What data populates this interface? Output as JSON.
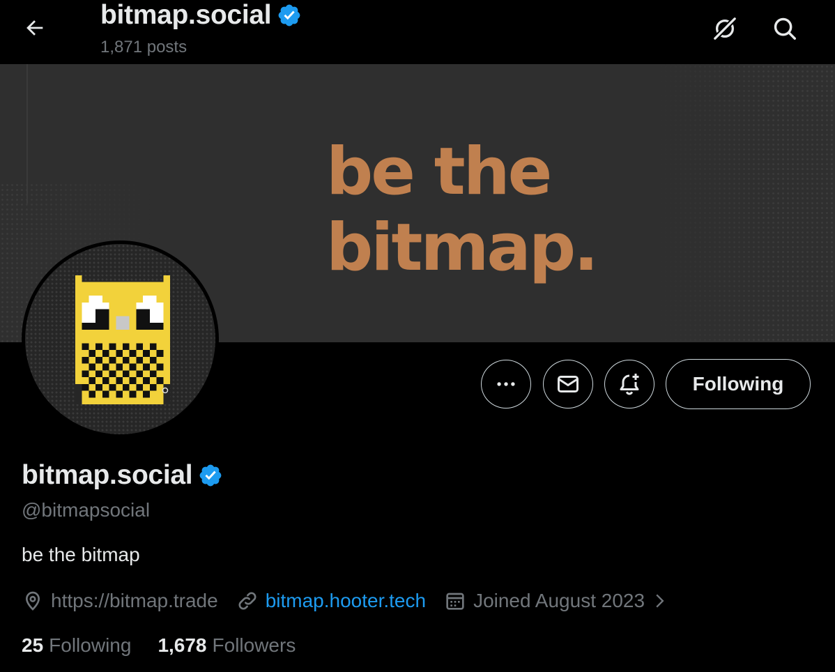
{
  "header": {
    "title": "bitmap.social",
    "posts_count": "1,871 posts"
  },
  "banner": {
    "tagline": "be the bitmap."
  },
  "actions": {
    "following_label": "Following"
  },
  "profile": {
    "display_name": "bitmap.social",
    "handle": "@bitmapsocial",
    "bio": "be the bitmap",
    "location": "https://bitmap.trade",
    "website": "bitmap.hooter.tech",
    "joined": "Joined August 2023",
    "following_count": "25",
    "following_label": "Following",
    "followers_count": "1,678",
    "followers_label": "Followers"
  },
  "colors": {
    "background": "#000000",
    "accent_blue": "#1d9bf0",
    "banner_bg": "#2f2f2f",
    "banner_text": "#c0804f",
    "owl_yellow": "#f2d23b",
    "muted_text": "#71767b"
  },
  "icons": {
    "back": "arrow-left-icon",
    "grok": "grok-slash-icon",
    "search": "search-icon",
    "more": "more-dots-icon",
    "message": "envelope-icon",
    "notify": "bell-plus-icon",
    "verified": "verified-badge-icon",
    "location": "location-pin-icon",
    "link": "link-icon",
    "calendar": "calendar-icon",
    "chevron": "chevron-right-icon"
  }
}
